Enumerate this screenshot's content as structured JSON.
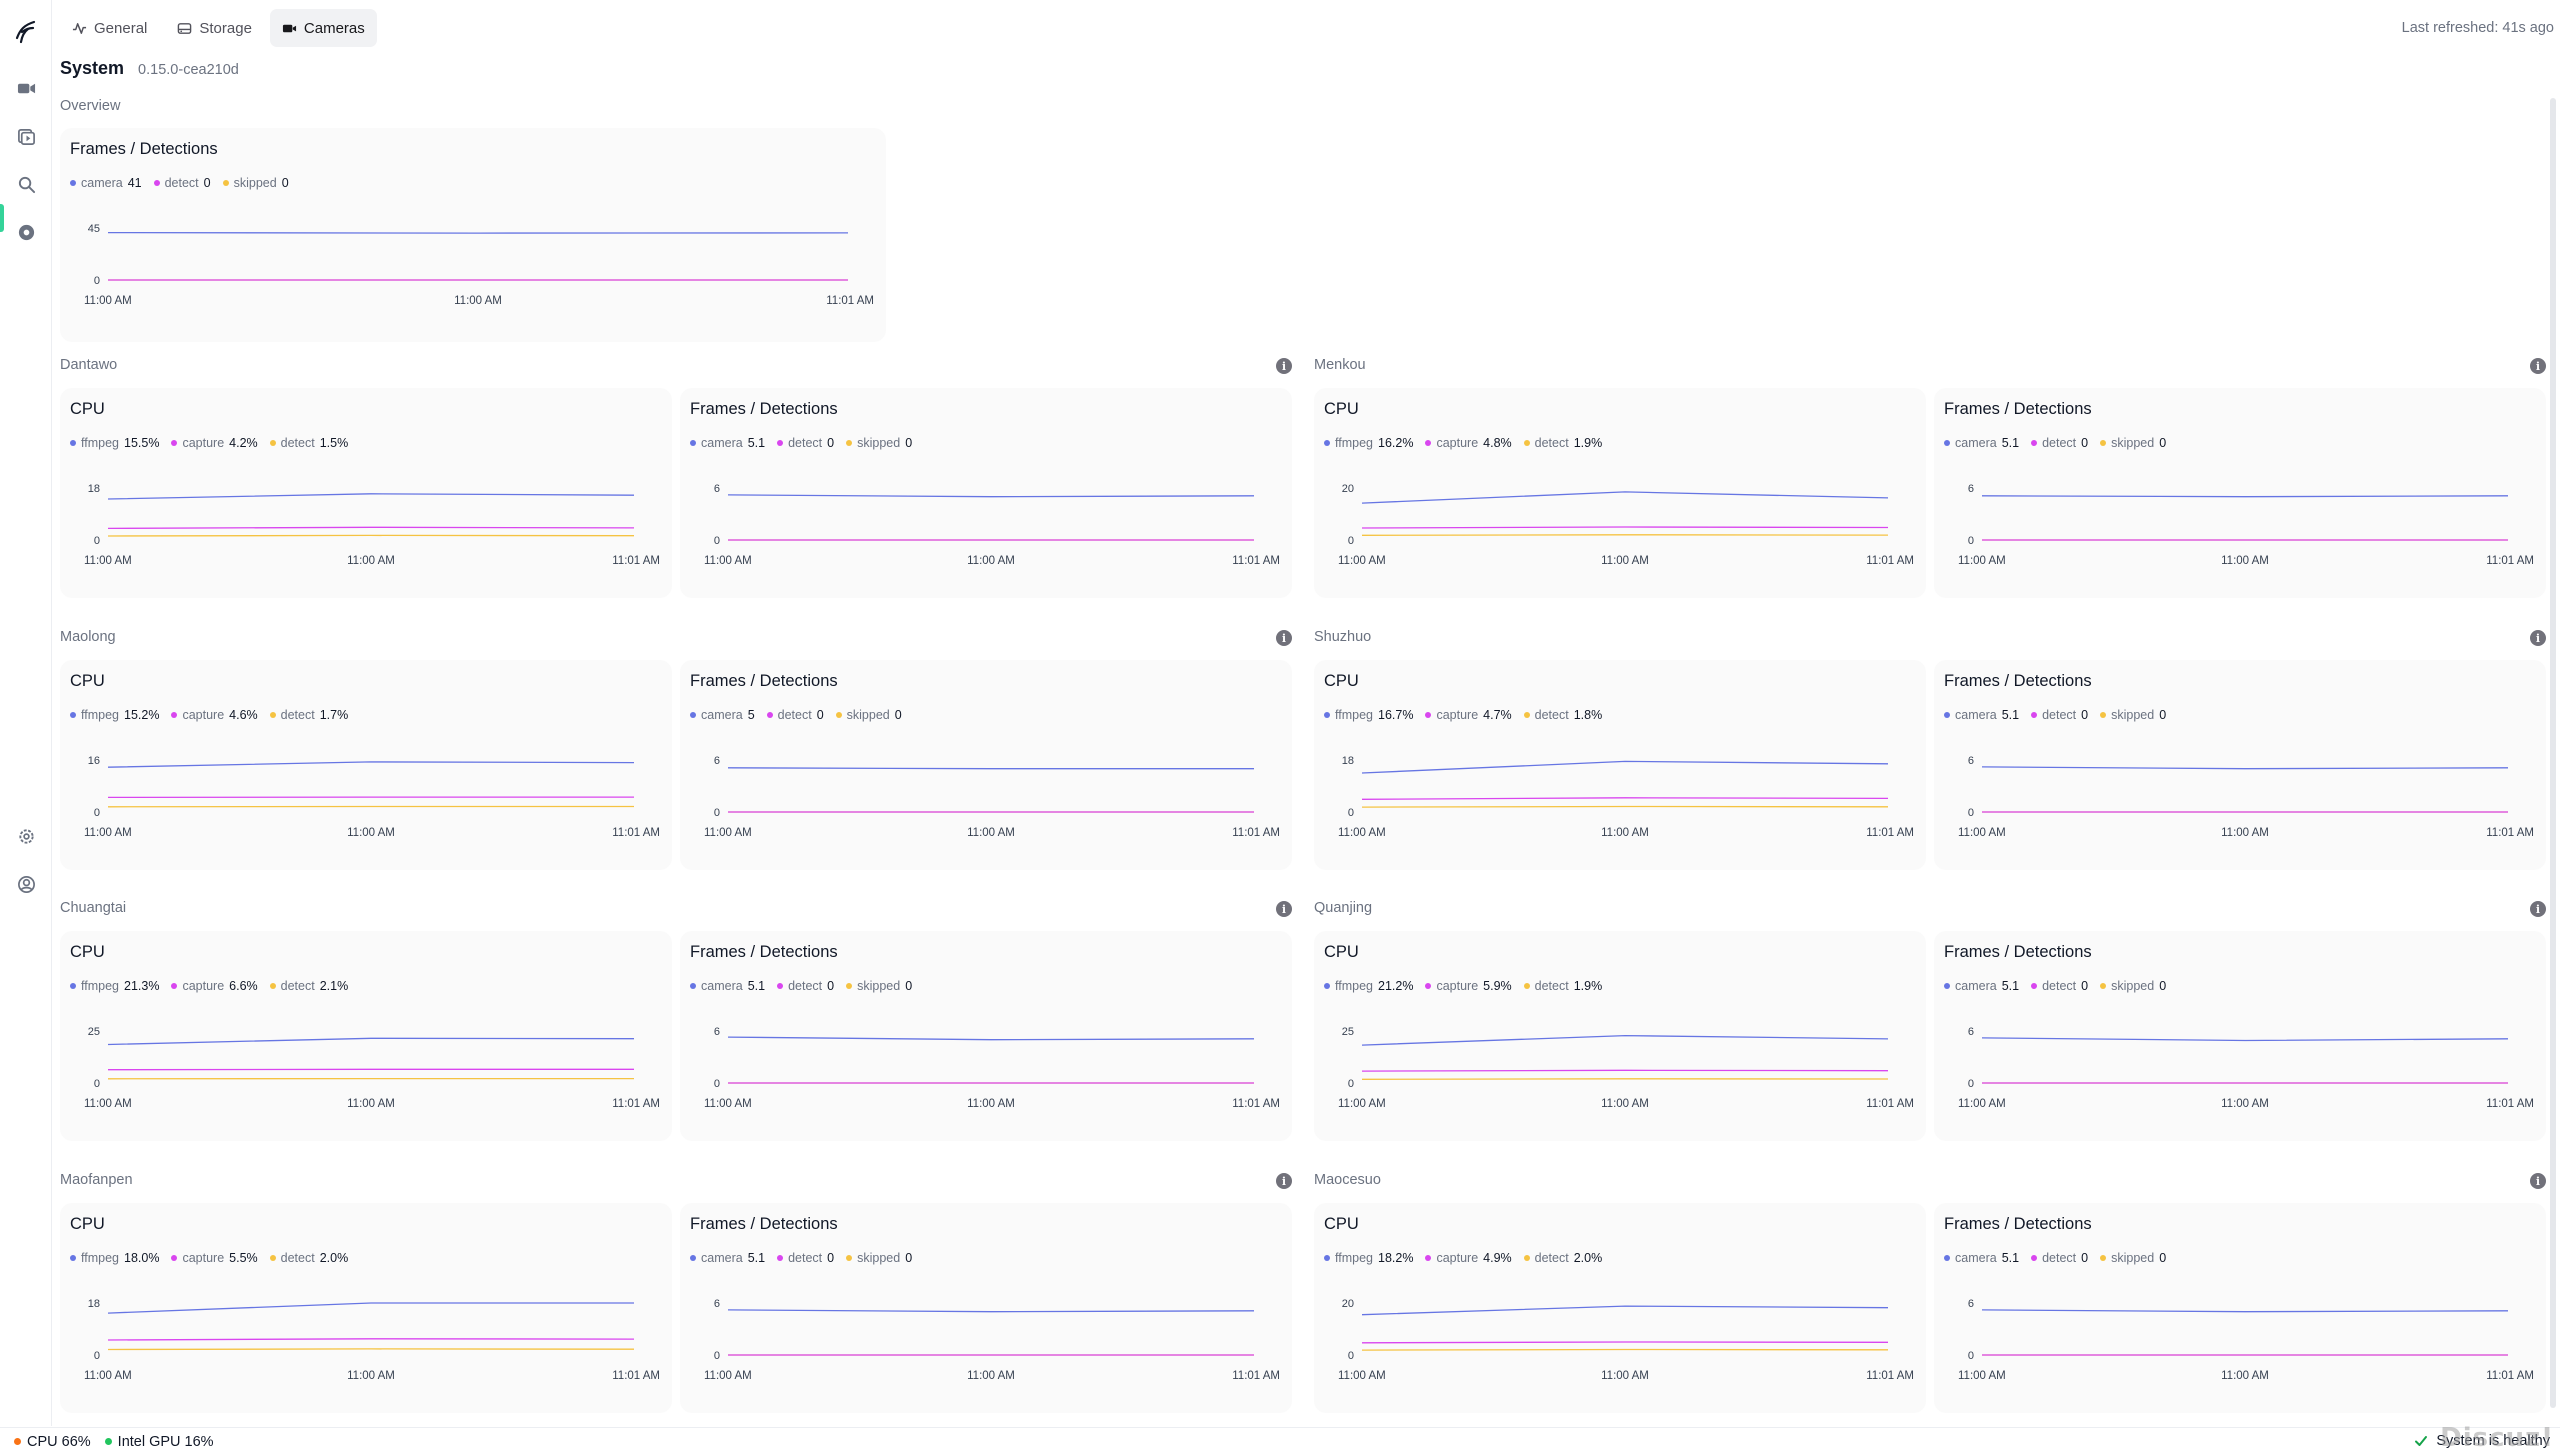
{
  "nav": {
    "tabs": [
      {
        "label": "General",
        "icon": "activity-icon"
      },
      {
        "label": "Storage",
        "icon": "hard-drive-icon"
      },
      {
        "label": "Cameras",
        "icon": "video-icon"
      }
    ],
    "active_tab": "Cameras",
    "last_refreshed": "Last refreshed: 41s ago"
  },
  "page": {
    "title": "System",
    "version": "0.15.0-cea210d",
    "overview_label": "Overview"
  },
  "overview": {
    "title": "Frames / Detections",
    "legend": [
      {
        "name": "camera",
        "value": "41",
        "color": "#6675e3"
      },
      {
        "name": "detect",
        "value": "0",
        "color": "#d946ef"
      },
      {
        "name": "skipped",
        "value": "0",
        "color": "#f5c342"
      }
    ],
    "ytick_top": "45",
    "ytick_bottom": "0",
    "xticks": [
      "11:00 AM",
      "11:00 AM",
      "11:01 AM"
    ]
  },
  "cameras": [
    {
      "name": "Dantawo",
      "cpu": {
        "title": "CPU",
        "legend": [
          {
            "name": "ffmpeg",
            "value": "15.5%"
          },
          {
            "name": "capture",
            "value": "4.2%"
          },
          {
            "name": "detect",
            "value": "1.5%"
          }
        ],
        "ytop": "18"
      },
      "frames": {
        "title": "Frames / Detections",
        "legend": [
          {
            "name": "camera",
            "value": "5.1"
          },
          {
            "name": "detect",
            "value": "0"
          },
          {
            "name": "skipped",
            "value": "0"
          }
        ],
        "ytop": "6"
      }
    },
    {
      "name": "Menkou",
      "cpu": {
        "title": "CPU",
        "legend": [
          {
            "name": "ffmpeg",
            "value": "16.2%"
          },
          {
            "name": "capture",
            "value": "4.8%"
          },
          {
            "name": "detect",
            "value": "1.9%"
          }
        ],
        "ytop": "20"
      },
      "frames": {
        "title": "Frames / Detections",
        "legend": [
          {
            "name": "camera",
            "value": "5.1"
          },
          {
            "name": "detect",
            "value": "0"
          },
          {
            "name": "skipped",
            "value": "0"
          }
        ],
        "ytop": "6"
      }
    },
    {
      "name": "Maolong",
      "cpu": {
        "title": "CPU",
        "legend": [
          {
            "name": "ffmpeg",
            "value": "15.2%"
          },
          {
            "name": "capture",
            "value": "4.6%"
          },
          {
            "name": "detect",
            "value": "1.7%"
          }
        ],
        "ytop": "16"
      },
      "frames": {
        "title": "Frames / Detections",
        "legend": [
          {
            "name": "camera",
            "value": "5"
          },
          {
            "name": "detect",
            "value": "0"
          },
          {
            "name": "skipped",
            "value": "0"
          }
        ],
        "ytop": "6"
      }
    },
    {
      "name": "Shuzhuo",
      "cpu": {
        "title": "CPU",
        "legend": [
          {
            "name": "ffmpeg",
            "value": "16.7%"
          },
          {
            "name": "capture",
            "value": "4.7%"
          },
          {
            "name": "detect",
            "value": "1.8%"
          }
        ],
        "ytop": "18"
      },
      "frames": {
        "title": "Frames / Detections",
        "legend": [
          {
            "name": "camera",
            "value": "5.1"
          },
          {
            "name": "detect",
            "value": "0"
          },
          {
            "name": "skipped",
            "value": "0"
          }
        ],
        "ytop": "6"
      }
    },
    {
      "name": "Chuangtai",
      "cpu": {
        "title": "CPU",
        "legend": [
          {
            "name": "ffmpeg",
            "value": "21.3%"
          },
          {
            "name": "capture",
            "value": "6.6%"
          },
          {
            "name": "detect",
            "value": "2.1%"
          }
        ],
        "ytop": "25"
      },
      "frames": {
        "title": "Frames / Detections",
        "legend": [
          {
            "name": "camera",
            "value": "5.1"
          },
          {
            "name": "detect",
            "value": "0"
          },
          {
            "name": "skipped",
            "value": "0"
          }
        ],
        "ytop": "6"
      }
    },
    {
      "name": "Quanjing",
      "cpu": {
        "title": "CPU",
        "legend": [
          {
            "name": "ffmpeg",
            "value": "21.2%"
          },
          {
            "name": "capture",
            "value": "5.9%"
          },
          {
            "name": "detect",
            "value": "1.9%"
          }
        ],
        "ytop": "25"
      },
      "frames": {
        "title": "Frames / Detections",
        "legend": [
          {
            "name": "camera",
            "value": "5.1"
          },
          {
            "name": "detect",
            "value": "0"
          },
          {
            "name": "skipped",
            "value": "0"
          }
        ],
        "ytop": "6"
      }
    },
    {
      "name": "Maofanpen",
      "cpu": {
        "title": "CPU",
        "legend": [
          {
            "name": "ffmpeg",
            "value": "18.0%"
          },
          {
            "name": "capture",
            "value": "5.5%"
          },
          {
            "name": "detect",
            "value": "2.0%"
          }
        ],
        "ytop": "18"
      },
      "frames": {
        "title": "Frames / Detections",
        "legend": [
          {
            "name": "camera",
            "value": "5.1"
          },
          {
            "name": "detect",
            "value": "0"
          },
          {
            "name": "skipped",
            "value": "0"
          }
        ],
        "ytop": "6"
      }
    },
    {
      "name": "Maocesuo",
      "cpu": {
        "title": "CPU",
        "legend": [
          {
            "name": "ffmpeg",
            "value": "18.2%"
          },
          {
            "name": "capture",
            "value": "4.9%"
          },
          {
            "name": "detect",
            "value": "2.0%"
          }
        ],
        "ytop": "20"
      },
      "frames": {
        "title": "Frames / Detections",
        "legend": [
          {
            "name": "camera",
            "value": "5.1"
          },
          {
            "name": "detect",
            "value": "0"
          },
          {
            "name": "skipped",
            "value": "0"
          }
        ],
        "ytop": "6"
      }
    }
  ],
  "chart_common": {
    "ybottom": "0",
    "xticks": [
      "11:00 AM",
      "11:00 AM",
      "11:01 AM"
    ],
    "series_colors": [
      "#6675e3",
      "#d946ef",
      "#f5c342"
    ]
  },
  "chart_data": [
    {
      "type": "line",
      "title": "Frames / Detections",
      "x": [
        "11:00 AM",
        "11:00 AM",
        "11:01 AM"
      ],
      "ylim": [
        0,
        45
      ],
      "series": [
        {
          "name": "camera",
          "values": [
            41,
            40.6,
            40.8
          ]
        },
        {
          "name": "detect",
          "values": [
            0,
            0,
            0
          ]
        },
        {
          "name": "skipped",
          "values": [
            0,
            0,
            0
          ]
        }
      ]
    },
    {
      "type": "line",
      "title": "CPU",
      "x": [
        "11:00 AM",
        "11:00 AM",
        "11:01 AM"
      ],
      "ylim": [
        0,
        18
      ],
      "series": [
        {
          "name": "ffmpeg",
          "values": [
            14.2,
            16,
            15.5
          ]
        },
        {
          "name": "capture",
          "values": [
            4,
            4.4,
            4.2
          ]
        },
        {
          "name": "detect",
          "values": [
            1.4,
            1.6,
            1.5
          ]
        }
      ]
    },
    {
      "type": "line",
      "title": "Frames / Detections",
      "x": [
        "11:00 AM",
        "11:00 AM",
        "11:01 AM"
      ],
      "ylim": [
        0,
        6
      ],
      "series": [
        {
          "name": "camera",
          "values": [
            5.2,
            5.0,
            5.1
          ]
        },
        {
          "name": "detect",
          "values": [
            0,
            0,
            0
          ]
        },
        {
          "name": "skipped",
          "values": [
            0,
            0,
            0
          ]
        }
      ]
    },
    {
      "type": "line",
      "title": "CPU",
      "x": [
        "11:00 AM",
        "11:00 AM",
        "11:01 AM"
      ],
      "ylim": [
        0,
        20
      ],
      "series": [
        {
          "name": "ffmpeg",
          "values": [
            14.2,
            18.5,
            16.2
          ]
        },
        {
          "name": "capture",
          "values": [
            4.6,
            5,
            4.8
          ]
        },
        {
          "name": "detect",
          "values": [
            1.8,
            2,
            1.9
          ]
        }
      ]
    },
    {
      "type": "line",
      "title": "Frames / Detections",
      "x": [
        "11:00 AM",
        "11:00 AM",
        "11:01 AM"
      ],
      "ylim": [
        0,
        6
      ],
      "series": [
        {
          "name": "camera",
          "values": [
            5.1,
            5.0,
            5.1
          ]
        },
        {
          "name": "detect",
          "values": [
            0,
            0,
            0
          ]
        },
        {
          "name": "skipped",
          "values": [
            0,
            0,
            0
          ]
        }
      ]
    },
    {
      "type": "line",
      "title": "CPU",
      "x": [
        "11:00 AM",
        "11:00 AM",
        "11:01 AM"
      ],
      "ylim": [
        0,
        16
      ],
      "series": [
        {
          "name": "ffmpeg",
          "values": [
            13.8,
            15.4,
            15.2
          ]
        },
        {
          "name": "capture",
          "values": [
            4.5,
            4.6,
            4.6
          ]
        },
        {
          "name": "detect",
          "values": [
            1.6,
            1.7,
            1.7
          ]
        }
      ]
    },
    {
      "type": "line",
      "title": "Frames / Detections",
      "x": [
        "11:00 AM",
        "11:00 AM",
        "11:01 AM"
      ],
      "ylim": [
        0,
        6
      ],
      "series": [
        {
          "name": "camera",
          "values": [
            5.1,
            5.0,
            5.0
          ]
        },
        {
          "name": "detect",
          "values": [
            0,
            0,
            0
          ]
        },
        {
          "name": "skipped",
          "values": [
            0,
            0,
            0
          ]
        }
      ]
    },
    {
      "type": "line",
      "title": "CPU",
      "x": [
        "11:00 AM",
        "11:00 AM",
        "11:01 AM"
      ],
      "ylim": [
        0,
        18
      ],
      "series": [
        {
          "name": "ffmpeg",
          "values": [
            13.5,
            17.5,
            16.7
          ]
        },
        {
          "name": "capture",
          "values": [
            4.4,
            4.9,
            4.7
          ]
        },
        {
          "name": "detect",
          "values": [
            1.7,
            1.9,
            1.8
          ]
        }
      ]
    },
    {
      "type": "line",
      "title": "Frames / Detections",
      "x": [
        "11:00 AM",
        "11:00 AM",
        "11:01 AM"
      ],
      "ylim": [
        0,
        6
      ],
      "series": [
        {
          "name": "camera",
          "values": [
            5.2,
            5.0,
            5.1
          ]
        },
        {
          "name": "detect",
          "values": [
            0,
            0,
            0
          ]
        },
        {
          "name": "skipped",
          "values": [
            0,
            0,
            0
          ]
        }
      ]
    },
    {
      "type": "line",
      "title": "CPU",
      "x": [
        "11:00 AM",
        "11:00 AM",
        "11:01 AM"
      ],
      "ylim": [
        0,
        25
      ],
      "series": [
        {
          "name": "ffmpeg",
          "values": [
            18.5,
            21.5,
            21.3
          ]
        },
        {
          "name": "capture",
          "values": [
            6.4,
            6.6,
            6.6
          ]
        },
        {
          "name": "detect",
          "values": [
            2.0,
            2.1,
            2.1
          ]
        }
      ]
    },
    {
      "type": "line",
      "title": "Frames / Detections",
      "x": [
        "11:00 AM",
        "11:00 AM",
        "11:01 AM"
      ],
      "ylim": [
        0,
        6
      ],
      "series": [
        {
          "name": "camera",
          "values": [
            5.3,
            5.0,
            5.1
          ]
        },
        {
          "name": "detect",
          "values": [
            0,
            0,
            0
          ]
        },
        {
          "name": "skipped",
          "values": [
            0,
            0,
            0
          ]
        }
      ]
    },
    {
      "type": "line",
      "title": "CPU",
      "x": [
        "11:00 AM",
        "11:00 AM",
        "11:01 AM"
      ],
      "ylim": [
        0,
        25
      ],
      "series": [
        {
          "name": "ffmpeg",
          "values": [
            18.2,
            22.8,
            21.2
          ]
        },
        {
          "name": "capture",
          "values": [
            5.7,
            6.1,
            5.9
          ]
        },
        {
          "name": "detect",
          "values": [
            1.8,
            2.0,
            1.9
          ]
        }
      ]
    },
    {
      "type": "line",
      "title": "Frames / Detections",
      "x": [
        "11:00 AM",
        "11:00 AM",
        "11:01 AM"
      ],
      "ylim": [
        0,
        6
      ],
      "series": [
        {
          "name": "camera",
          "values": [
            5.2,
            4.9,
            5.1
          ]
        },
        {
          "name": "detect",
          "values": [
            0,
            0,
            0
          ]
        },
        {
          "name": "skipped",
          "values": [
            0,
            0,
            0
          ]
        }
      ]
    },
    {
      "type": "line",
      "title": "CPU",
      "x": [
        "11:00 AM",
        "11:00 AM",
        "11:01 AM"
      ],
      "ylim": [
        0,
        18
      ],
      "series": [
        {
          "name": "ffmpeg",
          "values": [
            14.5,
            18.0,
            18.0
          ]
        },
        {
          "name": "capture",
          "values": [
            5.2,
            5.6,
            5.5
          ]
        },
        {
          "name": "detect",
          "values": [
            1.9,
            2.1,
            2.0
          ]
        }
      ]
    },
    {
      "type": "line",
      "title": "Frames / Detections",
      "x": [
        "11:00 AM",
        "11:00 AM",
        "11:01 AM"
      ],
      "ylim": [
        0,
        6
      ],
      "series": [
        {
          "name": "camera",
          "values": [
            5.2,
            5.0,
            5.1
          ]
        },
        {
          "name": "detect",
          "values": [
            0,
            0,
            0
          ]
        },
        {
          "name": "skipped",
          "values": [
            0,
            0,
            0
          ]
        }
      ]
    },
    {
      "type": "line",
      "title": "CPU",
      "x": [
        "11:00 AM",
        "11:00 AM",
        "11:01 AM"
      ],
      "ylim": [
        0,
        20
      ],
      "series": [
        {
          "name": "ffmpeg",
          "values": [
            15.5,
            18.8,
            18.2
          ]
        },
        {
          "name": "capture",
          "values": [
            4.7,
            5.0,
            4.9
          ]
        },
        {
          "name": "detect",
          "values": [
            1.9,
            2.1,
            2.0
          ]
        }
      ]
    },
    {
      "type": "line",
      "title": "Frames / Detections",
      "x": [
        "11:00 AM",
        "11:00 AM",
        "11:01 AM"
      ],
      "ylim": [
        0,
        6
      ],
      "series": [
        {
          "name": "camera",
          "values": [
            5.2,
            5.0,
            5.1
          ]
        },
        {
          "name": "detect",
          "values": [
            0,
            0,
            0
          ]
        },
        {
          "name": "skipped",
          "values": [
            0,
            0,
            0
          ]
        }
      ]
    }
  ],
  "footer": {
    "cpu": "CPU 66%",
    "cpu_color": "#f97316",
    "gpu": "Intel GPU 16%",
    "gpu_color": "#22c55e",
    "health": "System is healthy",
    "watermark": "Discuz!"
  }
}
